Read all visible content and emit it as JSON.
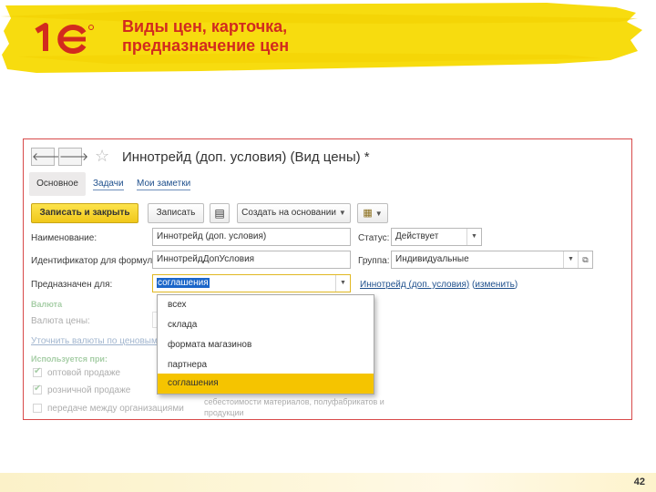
{
  "slide": {
    "title_line1": "Виды цен, карточка,",
    "title_line2": "предназначение цен",
    "page_number": "42",
    "logo": "1c-logo",
    "colors": {
      "accent_yellow": "#f5d90a",
      "title_red": "#d22b1e",
      "frame_border": "#d84a4a",
      "selected_item": "#f5c400",
      "primary_button": "#f0c81a"
    }
  },
  "window": {
    "title": "Иннотрейд (доп. условия) (Вид цены) *",
    "nav_back_icon": "arrow-left-icon",
    "nav_forward_icon": "arrow-right-icon",
    "favorite_icon": "star-icon",
    "tabs": [
      {
        "label": "Основное",
        "active": true
      },
      {
        "label": "Задачи",
        "active": false
      },
      {
        "label": "Мои заметки",
        "active": false
      }
    ]
  },
  "toolbar": {
    "save_close_label": "Записать и закрыть",
    "save_label": "Записать",
    "list_icon": "document-list-icon",
    "create_based_label": "Создать на основании",
    "report_icon": "report-icon"
  },
  "form": {
    "name_label": "Наименование:",
    "name_value": "Иннотрейд (доп. условия)",
    "status_label": "Статус:",
    "status_value": "Действует",
    "formula_id_label": "Идентификатор для формул:",
    "formula_id_value": "ИннотрейдДопУсловия",
    "group_label": "Группа:",
    "group_value": "Индивидуальные",
    "purpose_label": "Предназначен для:",
    "purpose_value": "соглашения",
    "purpose_link": "Иннотрейд (доп. условия)",
    "purpose_change_link": "изменить"
  },
  "background": {
    "currency_header": "Валюта",
    "currency_label": "Валюта цены:",
    "currency_link": "Уточнить валюты по ценовым",
    "usage_header": "Используется при:",
    "usage_items": [
      {
        "label": "оптовой продаже",
        "checked": true
      },
      {
        "label": "розничной продаже",
        "checked": true
      },
      {
        "label": "передаче между организациями",
        "checked": false
      }
    ],
    "cost_note_line1": "себестоимости материалов, полуфабрикатов и",
    "cost_note_line2": "продукции"
  },
  "dropdown": {
    "options": [
      "всех",
      "склада",
      "формата магазинов",
      "партнера",
      "соглашения"
    ],
    "selected": "соглашения"
  }
}
